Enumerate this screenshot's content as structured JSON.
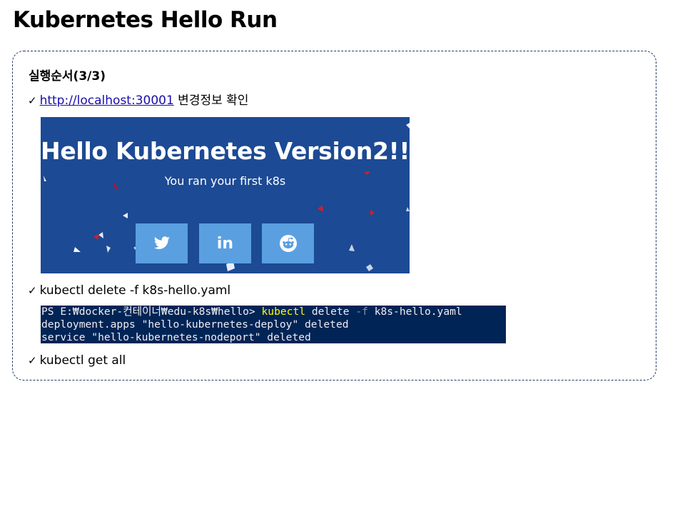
{
  "slide": {
    "title": "Kubernetes Hello Run"
  },
  "content": {
    "heading": "실행순서(3/3)",
    "check_glyph": "✓",
    "step1": {
      "link": "http://localhost:30001",
      "text": " 변경정보 확인"
    },
    "hello_screenshot": {
      "heading": "Hello Kubernetes Version2!!!",
      "subheading": "You ran your first k8s",
      "share_buttons": [
        "twitter-icon",
        "linkedin-icon",
        "reddit-icon"
      ],
      "linkedin_label": "in",
      "background_color": "#1c4a94",
      "button_color": "#5a9fe0"
    },
    "step2": {
      "text": "kubectl delete -f k8s-hello.yaml"
    },
    "terminal": {
      "line1": {
        "prompt": "PS E:₩docker-컨테이너₩edu-k8s₩hello> ",
        "cmd": "kubectl",
        "arg1": " delete ",
        "flag": "-f",
        "arg2": " k8s-hello.yaml"
      },
      "line2": "deployment.apps \"hello-kubernetes-deploy\" deleted",
      "line3": "service \"hello-kubernetes-nodeport\" deleted",
      "background_color": "#012456"
    },
    "step3": {
      "text": "kubectl get all"
    }
  }
}
